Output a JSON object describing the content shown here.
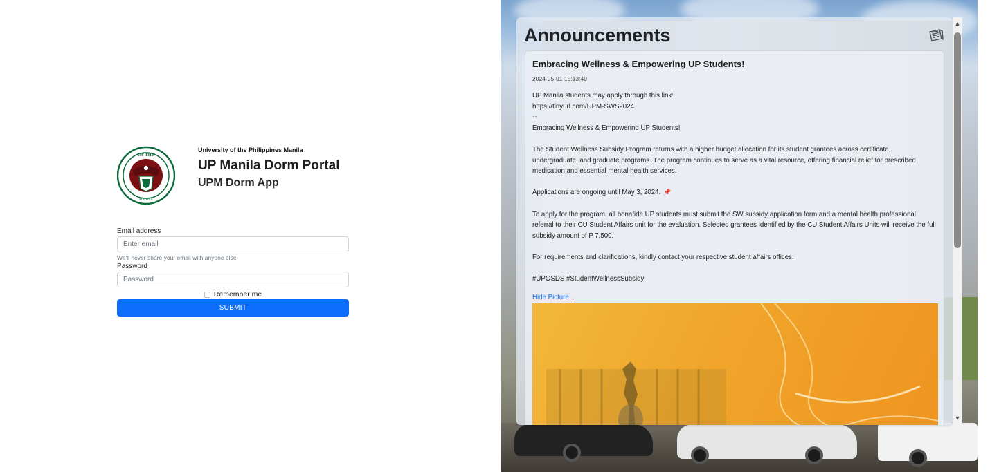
{
  "login": {
    "university": "University of the Philippines Manila",
    "portal_title": "UP Manila Dorm Portal",
    "app_name": "UPM Dorm App",
    "email_label": "Email address",
    "email_placeholder": "Enter email",
    "email_help": "We'll never share your email with anyone else.",
    "password_label": "Password",
    "password_placeholder": "Password",
    "remember_label": "Remember me",
    "remember_checked": false,
    "submit_label": "SUBMIT"
  },
  "announcements": {
    "title": "Announcements",
    "icon": "newspaper-icon",
    "items": [
      {
        "title": "Embracing Wellness & Empowering UP Students!",
        "date": "2024-05-01 15:13:40",
        "lines": [
          "UP Manila students may apply through this link:",
          "https://tinyurl.com/UPM-SWS2024",
          "--",
          "Embracing Wellness & Empowering UP Students!"
        ],
        "paragraph1": "The Student Wellness Subsidy Program returns with a higher budget allocation for its student grantees across certificate, undergraduate, and graduate programs. The program continues to serve as a vital resource, offering financial relief for prescribed medication and essential mental health services.",
        "paragraph2": "Applications are ongoing until May 3, 2024.",
        "paragraph3": "To apply for the program, all bonafide UP students must submit the SW subsidy application form and a mental health professional referral to their CU Student Affairs unit for the evaluation. Selected grantees identified by the CU Student Affairs Units will receive the full subsidy amount of P 7,500.",
        "paragraph4": "For requirements and clarifications, kindly contact your respective student affairs offices.",
        "hashtags": "#UPOSDS #StudentWellnessSubsidy",
        "toggle_picture_label": "Hide Picture..."
      }
    ]
  },
  "colors": {
    "primary": "#0d6efd",
    "seal_maroon": "#7b1113",
    "seal_green": "#0b6b3a",
    "poster_orange": "#f0a52a"
  }
}
